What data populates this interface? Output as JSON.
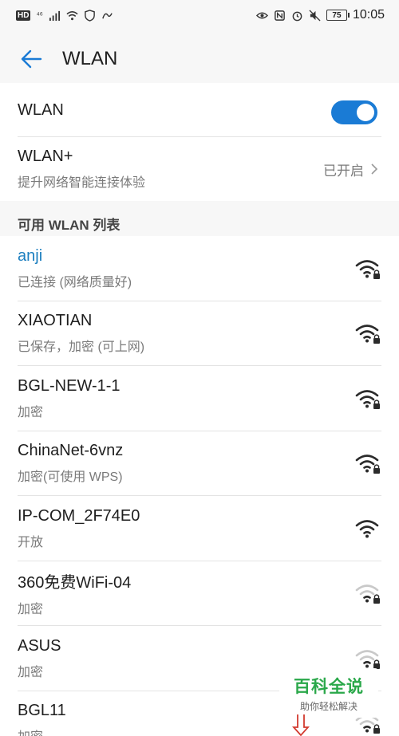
{
  "status_bar": {
    "hd": "HD",
    "signal": "⁴⁶",
    "battery": "75",
    "time": "10:05"
  },
  "header": {
    "title": "WLAN"
  },
  "wlan_toggle": {
    "label": "WLAN",
    "enabled": true
  },
  "wlan_plus": {
    "title": "WLAN+",
    "subtitle": "提升网络智能连接体验",
    "status": "已开启"
  },
  "section": {
    "label": "可用 WLAN 列表"
  },
  "networks": [
    {
      "name": "anji",
      "status": "已连接 (网络质量好)",
      "locked": true,
      "connected": true,
      "strength": "full"
    },
    {
      "name": "XIAOTIAN",
      "status": "已保存，加密 (可上网)",
      "locked": true,
      "connected": false,
      "strength": "full"
    },
    {
      "name": "BGL-NEW-1-1",
      "status": "加密",
      "locked": true,
      "connected": false,
      "strength": "full"
    },
    {
      "name": "ChinaNet-6vnz",
      "status": "加密(可使用 WPS)",
      "locked": true,
      "connected": false,
      "strength": "full"
    },
    {
      "name": "IP-COM_2F74E0",
      "status": "开放",
      "locked": false,
      "connected": false,
      "strength": "full"
    },
    {
      "name": "360免费WiFi-04",
      "status": "加密",
      "locked": true,
      "connected": false,
      "strength": "weak"
    },
    {
      "name": "ASUS",
      "status": "加密",
      "locked": true,
      "connected": false,
      "strength": "weak"
    },
    {
      "name": "BGL11",
      "status": "加密",
      "locked": true,
      "connected": false,
      "strength": "weak"
    }
  ],
  "watermark": {
    "logo": "百科全说",
    "tagline": "助你轻松解决"
  },
  "colors": {
    "accent": "#1a7bd5",
    "connected_text": "#1d7fbf",
    "watermark_green": "#2aa84a"
  }
}
